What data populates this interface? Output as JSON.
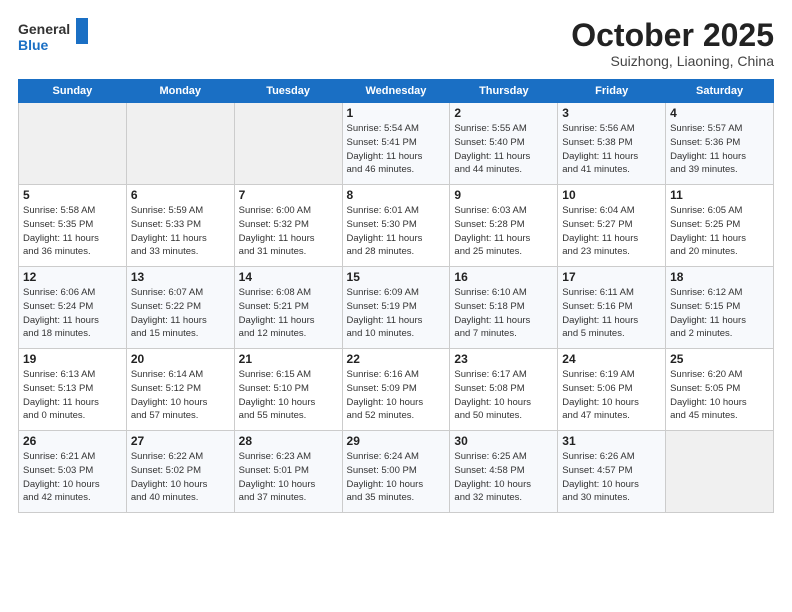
{
  "logo": {
    "line1": "General",
    "line2": "Blue"
  },
  "title": "October 2025",
  "subtitle": "Suizhong, Liaoning, China",
  "days_of_week": [
    "Sunday",
    "Monday",
    "Tuesday",
    "Wednesday",
    "Thursday",
    "Friday",
    "Saturday"
  ],
  "weeks": [
    [
      {
        "day": "",
        "info": ""
      },
      {
        "day": "",
        "info": ""
      },
      {
        "day": "",
        "info": ""
      },
      {
        "day": "1",
        "info": "Sunrise: 5:54 AM\nSunset: 5:41 PM\nDaylight: 11 hours\nand 46 minutes."
      },
      {
        "day": "2",
        "info": "Sunrise: 5:55 AM\nSunset: 5:40 PM\nDaylight: 11 hours\nand 44 minutes."
      },
      {
        "day": "3",
        "info": "Sunrise: 5:56 AM\nSunset: 5:38 PM\nDaylight: 11 hours\nand 41 minutes."
      },
      {
        "day": "4",
        "info": "Sunrise: 5:57 AM\nSunset: 5:36 PM\nDaylight: 11 hours\nand 39 minutes."
      }
    ],
    [
      {
        "day": "5",
        "info": "Sunrise: 5:58 AM\nSunset: 5:35 PM\nDaylight: 11 hours\nand 36 minutes."
      },
      {
        "day": "6",
        "info": "Sunrise: 5:59 AM\nSunset: 5:33 PM\nDaylight: 11 hours\nand 33 minutes."
      },
      {
        "day": "7",
        "info": "Sunrise: 6:00 AM\nSunset: 5:32 PM\nDaylight: 11 hours\nand 31 minutes."
      },
      {
        "day": "8",
        "info": "Sunrise: 6:01 AM\nSunset: 5:30 PM\nDaylight: 11 hours\nand 28 minutes."
      },
      {
        "day": "9",
        "info": "Sunrise: 6:03 AM\nSunset: 5:28 PM\nDaylight: 11 hours\nand 25 minutes."
      },
      {
        "day": "10",
        "info": "Sunrise: 6:04 AM\nSunset: 5:27 PM\nDaylight: 11 hours\nand 23 minutes."
      },
      {
        "day": "11",
        "info": "Sunrise: 6:05 AM\nSunset: 5:25 PM\nDaylight: 11 hours\nand 20 minutes."
      }
    ],
    [
      {
        "day": "12",
        "info": "Sunrise: 6:06 AM\nSunset: 5:24 PM\nDaylight: 11 hours\nand 18 minutes."
      },
      {
        "day": "13",
        "info": "Sunrise: 6:07 AM\nSunset: 5:22 PM\nDaylight: 11 hours\nand 15 minutes."
      },
      {
        "day": "14",
        "info": "Sunrise: 6:08 AM\nSunset: 5:21 PM\nDaylight: 11 hours\nand 12 minutes."
      },
      {
        "day": "15",
        "info": "Sunrise: 6:09 AM\nSunset: 5:19 PM\nDaylight: 11 hours\nand 10 minutes."
      },
      {
        "day": "16",
        "info": "Sunrise: 6:10 AM\nSunset: 5:18 PM\nDaylight: 11 hours\nand 7 minutes."
      },
      {
        "day": "17",
        "info": "Sunrise: 6:11 AM\nSunset: 5:16 PM\nDaylight: 11 hours\nand 5 minutes."
      },
      {
        "day": "18",
        "info": "Sunrise: 6:12 AM\nSunset: 5:15 PM\nDaylight: 11 hours\nand 2 minutes."
      }
    ],
    [
      {
        "day": "19",
        "info": "Sunrise: 6:13 AM\nSunset: 5:13 PM\nDaylight: 11 hours\nand 0 minutes."
      },
      {
        "day": "20",
        "info": "Sunrise: 6:14 AM\nSunset: 5:12 PM\nDaylight: 10 hours\nand 57 minutes."
      },
      {
        "day": "21",
        "info": "Sunrise: 6:15 AM\nSunset: 5:10 PM\nDaylight: 10 hours\nand 55 minutes."
      },
      {
        "day": "22",
        "info": "Sunrise: 6:16 AM\nSunset: 5:09 PM\nDaylight: 10 hours\nand 52 minutes."
      },
      {
        "day": "23",
        "info": "Sunrise: 6:17 AM\nSunset: 5:08 PM\nDaylight: 10 hours\nand 50 minutes."
      },
      {
        "day": "24",
        "info": "Sunrise: 6:19 AM\nSunset: 5:06 PM\nDaylight: 10 hours\nand 47 minutes."
      },
      {
        "day": "25",
        "info": "Sunrise: 6:20 AM\nSunset: 5:05 PM\nDaylight: 10 hours\nand 45 minutes."
      }
    ],
    [
      {
        "day": "26",
        "info": "Sunrise: 6:21 AM\nSunset: 5:03 PM\nDaylight: 10 hours\nand 42 minutes."
      },
      {
        "day": "27",
        "info": "Sunrise: 6:22 AM\nSunset: 5:02 PM\nDaylight: 10 hours\nand 40 minutes."
      },
      {
        "day": "28",
        "info": "Sunrise: 6:23 AM\nSunset: 5:01 PM\nDaylight: 10 hours\nand 37 minutes."
      },
      {
        "day": "29",
        "info": "Sunrise: 6:24 AM\nSunset: 5:00 PM\nDaylight: 10 hours\nand 35 minutes."
      },
      {
        "day": "30",
        "info": "Sunrise: 6:25 AM\nSunset: 4:58 PM\nDaylight: 10 hours\nand 32 minutes."
      },
      {
        "day": "31",
        "info": "Sunrise: 6:26 AM\nSunset: 4:57 PM\nDaylight: 10 hours\nand 30 minutes."
      },
      {
        "day": "",
        "info": ""
      }
    ]
  ]
}
